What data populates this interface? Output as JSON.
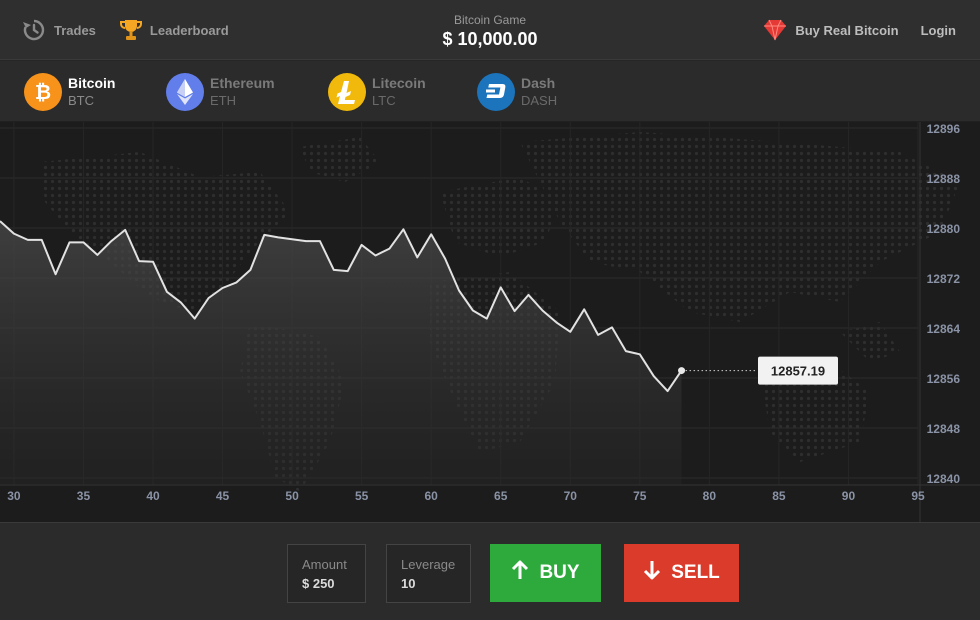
{
  "header": {
    "trades_label": "Trades",
    "leaderboard_label": "Leaderboard",
    "game_label": "Bitcoin Game",
    "balance": "$ 10,000.00",
    "buy_real_label": "Buy Real Bitcoin",
    "login_label": "Login"
  },
  "coins": [
    {
      "name": "Bitcoin",
      "symbol": "BTC",
      "active": true,
      "color": "#f7931a",
      "icon": "bitcoin-icon"
    },
    {
      "name": "Ethereum",
      "symbol": "ETH",
      "active": false,
      "color": "#627eea",
      "icon": "ethereum-icon"
    },
    {
      "name": "Litecoin",
      "symbol": "LTC",
      "active": false,
      "color": "#f0b90b",
      "icon": "litecoin-icon"
    },
    {
      "name": "Dash",
      "symbol": "DASH",
      "active": false,
      "color": "#1c75bc",
      "icon": "dash-icon"
    }
  ],
  "chart_data": {
    "type": "line",
    "title": "",
    "xlabel": "",
    "ylabel": "",
    "x_ticks": [
      30,
      35,
      40,
      45,
      50,
      55,
      60,
      65,
      70,
      75,
      80,
      85,
      90,
      95
    ],
    "y_ticks": [
      12840,
      12848,
      12856,
      12864,
      12872,
      12880,
      12888,
      12896
    ],
    "xlim": [
      29.0,
      95.0
    ],
    "ylim": [
      12840,
      12896
    ],
    "grid": true,
    "current_value": "12857.19",
    "x": [
      29,
      30,
      31,
      32,
      33,
      34,
      35,
      36,
      37,
      38,
      39,
      40,
      41,
      42,
      43,
      44,
      45,
      46,
      47,
      48,
      49,
      50,
      51,
      52,
      53,
      54,
      55,
      56,
      57,
      58,
      59,
      60,
      61,
      62,
      63,
      64,
      65,
      66,
      67,
      68,
      69,
      70,
      71,
      72,
      73,
      74,
      75,
      76,
      77,
      78
    ],
    "values": [
      12881.1,
      12879.1,
      12878.1,
      12878.1,
      12872.6,
      12877.7,
      12877.7,
      12875.7,
      12877.9,
      12879.7,
      12874.7,
      12874.6,
      12869.8,
      12868.1,
      12865.5,
      12868.8,
      12870.4,
      12871.3,
      12873.3,
      12878.9,
      12878.5,
      12878.2,
      12877.9,
      12877.9,
      12873.3,
      12873.1,
      12877.3,
      12875.6,
      12876.7,
      12879.8,
      12875.3,
      12879.0,
      12875.1,
      12870.0,
      12866.8,
      12865.5,
      12870.5,
      12866.7,
      12869.3,
      12866.8,
      12864.9,
      12863.4,
      12867.0,
      12862.9,
      12864.1,
      12860.3,
      12859.8,
      12856.3,
      12853.9,
      12857.19
    ]
  },
  "controls": {
    "amount_label": "Amount",
    "amount_value": "$ 250",
    "leverage_label": "Leverage",
    "leverage_value": "10",
    "buy_label": "BUY",
    "sell_label": "SELL",
    "buy_color": "#2eaa3c",
    "sell_color": "#db3b2a"
  }
}
